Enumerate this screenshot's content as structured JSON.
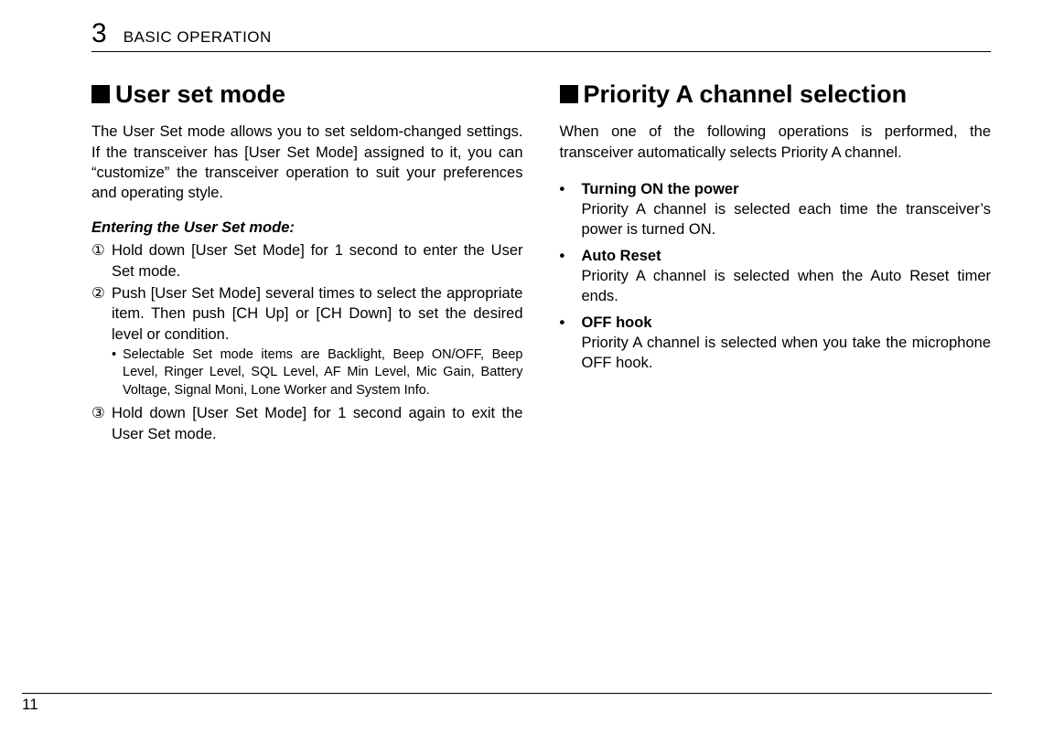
{
  "header": {
    "chapter_number": "3",
    "chapter_title": "BASIC OPERATION"
  },
  "left": {
    "heading": "User set mode",
    "intro": "The User Set mode allows you to set seldom-changed settings. If the transceiver has [User Set Mode] assigned to it, you can “customize” the transceiver operation to suit your preferences and operating style.",
    "subheading": "Entering the User Set mode:",
    "steps": [
      {
        "marker": "①",
        "text": "Hold down [User Set Mode] for 1 second to enter the User Set mode."
      },
      {
        "marker": "②",
        "text": "Push [User Set Mode] several times to select the appropriate item. Then push [CH Up] or [CH Down] to set the desired level or condition."
      }
    ],
    "note": {
      "bullet": "•",
      "text": "Selectable Set mode items are Backlight, Beep ON/OFF, Beep Level, Ringer Level, SQL Level, AF Min Level, Mic Gain, Battery Voltage, Signal Moni, Lone Worker and System Info."
    },
    "steps_after": [
      {
        "marker": "③",
        "text": "Hold down [User Set Mode] for 1 second again to exit the User Set mode."
      }
    ]
  },
  "right": {
    "heading": "Priority A channel selection",
    "intro": "When one of the following operations is performed, the transceiver automatically selects Priority A channel.",
    "items": [
      {
        "title": "Turning ON the power",
        "body": "Priority A channel is selected each time the transceiver’s power is turned ON."
      },
      {
        "title": "Auto Reset",
        "body": "Priority A channel is selected when the Auto Reset timer ends."
      },
      {
        "title": "OFF hook",
        "body": "Priority A channel is selected when you take the microphone OFF hook."
      }
    ]
  },
  "page_number": "11"
}
